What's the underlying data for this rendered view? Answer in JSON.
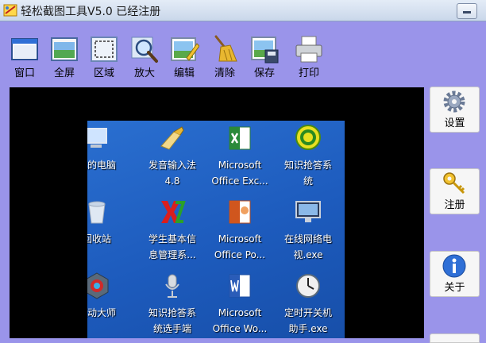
{
  "window": {
    "title": "轻松截图工具V5.0 已经注册"
  },
  "toolbar": [
    {
      "id": "window",
      "label": "窗口",
      "icon": "window-icon"
    },
    {
      "id": "fullscreen",
      "label": "全屏",
      "icon": "fullscreen-icon"
    },
    {
      "id": "region",
      "label": "区域",
      "icon": "region-icon"
    },
    {
      "id": "zoom",
      "label": "放大",
      "icon": "zoom-icon"
    },
    {
      "id": "edit",
      "label": "编辑",
      "icon": "edit-icon"
    },
    {
      "id": "clear",
      "label": "清除",
      "icon": "broom-icon"
    },
    {
      "id": "save",
      "label": "保存",
      "icon": "save-icon"
    },
    {
      "id": "print",
      "label": "打印",
      "icon": "printer-icon"
    }
  ],
  "side_buttons": [
    {
      "id": "settings",
      "label": "设置",
      "icon": "gear-icon"
    },
    {
      "id": "register",
      "label": "注册",
      "icon": "key-icon"
    },
    {
      "id": "about",
      "label": "关于",
      "icon": "info-icon"
    }
  ],
  "desktop_icons": [
    {
      "line1": "我的电脑",
      "line2": "",
      "icon": "computer-icon"
    },
    {
      "line1": "发音输入法",
      "line2": "4.8",
      "icon": "pen-icon"
    },
    {
      "line1": "Microsoft",
      "line2": "Office Exc...",
      "icon": "excel-icon"
    },
    {
      "line1": "知识抢答系",
      "line2": "统",
      "icon": "quiz-icon"
    },
    {
      "line1": "回收站",
      "line2": "",
      "icon": "recycle-bin-icon"
    },
    {
      "line1": "学生基本信",
      "line2": "息管理系...",
      "icon": "xs-icon"
    },
    {
      "line1": "Microsoft",
      "line2": "Office Po...",
      "icon": "powerpoint-icon"
    },
    {
      "line1": "在线网络电",
      "line2": "视.exe",
      "icon": "monitor-icon"
    },
    {
      "line1": "驱动大师",
      "line2": "",
      "icon": "driver-icon"
    },
    {
      "line1": "知识抢答系",
      "line2": "统选手端",
      "icon": "microphone-icon"
    },
    {
      "line1": "Microsoft",
      "line2": "Office Wo...",
      "icon": "word-icon"
    },
    {
      "line1": "定时开关机",
      "line2": "助手.exe",
      "icon": "clock-icon"
    }
  ],
  "colors": {
    "background": "#9a94ea",
    "canvas": "#000000",
    "desktop": "#1d5bbd"
  }
}
